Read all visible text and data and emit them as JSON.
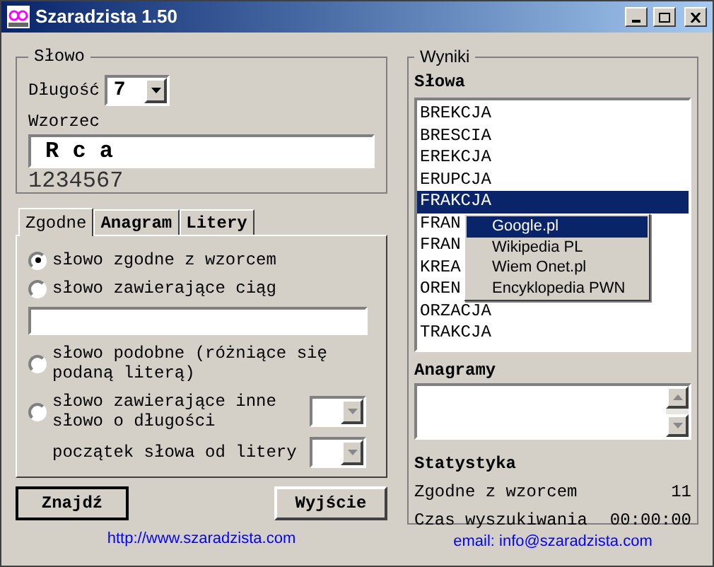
{
  "window": {
    "title": "Szaradzista 1.50"
  },
  "slowo": {
    "title": "Słowo",
    "length_label": "Długość",
    "length_value": "7",
    "pattern_label": "Wzorzec",
    "pattern_value": "R c a",
    "ruler": "1234567"
  },
  "tabs": [
    {
      "label": "Zgodne",
      "selected": true
    },
    {
      "label": "Anagram",
      "selected": false
    },
    {
      "label": "Litery",
      "selected": false
    }
  ],
  "options": [
    {
      "kind": "radio",
      "label": "słowo zgodne z wzorcem",
      "selected": true
    },
    {
      "kind": "radio",
      "label": "słowo zawierające ciąg",
      "selected": false
    },
    {
      "kind": "field"
    },
    {
      "kind": "radio",
      "label": "słowo podobne (różniące się podaną literą)",
      "selected": false
    },
    {
      "kind": "radio-combo",
      "label": "słowo zawierające inne słowo o długości",
      "selected": false
    },
    {
      "kind": "combo-row",
      "label": "początek słowa od litery"
    }
  ],
  "buttons": [
    "Znajdź",
    "Wyjście"
  ],
  "links": {
    "website": "http://www.szaradzista.com",
    "email": "email: info@szaradzista.com"
  },
  "wyniki": {
    "title": "Wyniki",
    "words_label": "Słowa",
    "words": [
      {
        "text": "BREKCJA",
        "selected": false
      },
      {
        "text": "BRESCIA",
        "selected": false
      },
      {
        "text": "EREKCJA",
        "selected": false
      },
      {
        "text": "ERUPCJA",
        "selected": false
      },
      {
        "text": "FRAKCJA",
        "selected": true
      },
      {
        "text": "FRAN",
        "selected": false
      },
      {
        "text": "FRAN",
        "selected": false
      },
      {
        "text": "KREA",
        "selected": false
      },
      {
        "text": "OREN",
        "selected": false
      },
      {
        "text": "ORZACJA",
        "selected": false
      },
      {
        "text": "TRAKCJA",
        "selected": false
      }
    ],
    "anagrams_label": "Anagramy",
    "stats_label": "Statystyka",
    "stats": [
      {
        "label": "Zgodne z wzorcem",
        "value": "11"
      },
      {
        "label": "Czas wyszukiwania",
        "value": "00:00:00"
      }
    ]
  },
  "context_menu": [
    {
      "label": "Google.pl",
      "selected": true
    },
    {
      "label": "Wikipedia PL",
      "selected": false
    },
    {
      "label": "Wiem Onet.pl",
      "selected": false
    },
    {
      "label": "Encyklopedia PWN",
      "selected": false
    }
  ]
}
